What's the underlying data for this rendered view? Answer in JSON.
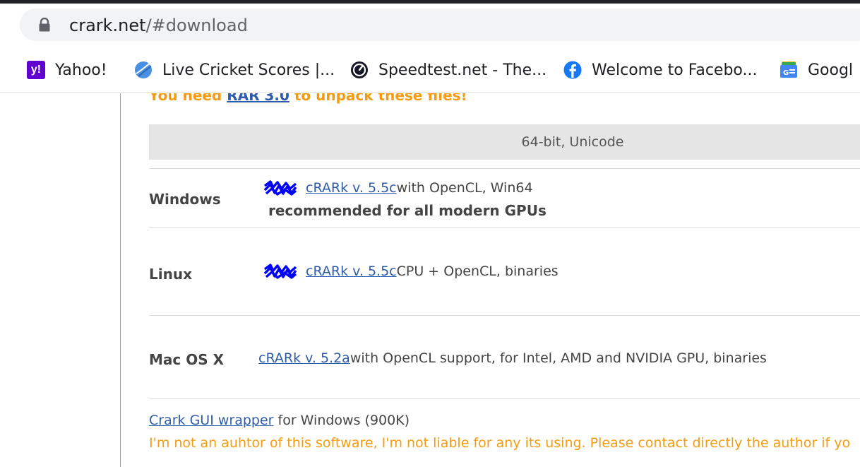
{
  "browser": {
    "url_host": "crark.net",
    "url_path": "/#download",
    "bookmarks": [
      {
        "label": "Yahoo!",
        "icon": "yahoo-icon",
        "glyph": "y!"
      },
      {
        "label": "Live Cricket Scores |...",
        "icon": "cricket-ball-icon"
      },
      {
        "label": "Speedtest.net - The...",
        "icon": "speedtest-icon"
      },
      {
        "label": "Welcome to Facebo...",
        "icon": "facebook-icon"
      },
      {
        "label": "Googl",
        "icon": "google-news-icon"
      }
    ]
  },
  "page": {
    "top_note": {
      "before": "You need ",
      "link": "RAR 3.0",
      "after": " to unpack these files!"
    },
    "header_band": "64-bit, Unicode",
    "rows": [
      {
        "os": "Windows",
        "link": "cRARk v. 5.5c",
        "suffix": " with OpenCL, Win64",
        "note": "recommended for all modern GPUs"
      },
      {
        "os": "Linux",
        "link": "cRARk v. 5.5c",
        "suffix": " CPU + OpenCL, binaries"
      },
      {
        "os": "Mac OS X",
        "link": "cRARk v. 5.2a",
        "suffix": " with OpenCL support, for Intel, AMD and NVIDIA GPU, binaries"
      }
    ],
    "gui": {
      "link": "Crark GUI wrapper",
      "suffix": " for Windows (900K)"
    },
    "disclaimer": "I'm not an auhtor of this software, I'm not liable for any its using. Please contact directly the author if yo"
  },
  "colors": {
    "orange": "#f39c12",
    "link": "#2f5ca8",
    "scribble": "#0000ff",
    "band": "#e5e5e5"
  }
}
